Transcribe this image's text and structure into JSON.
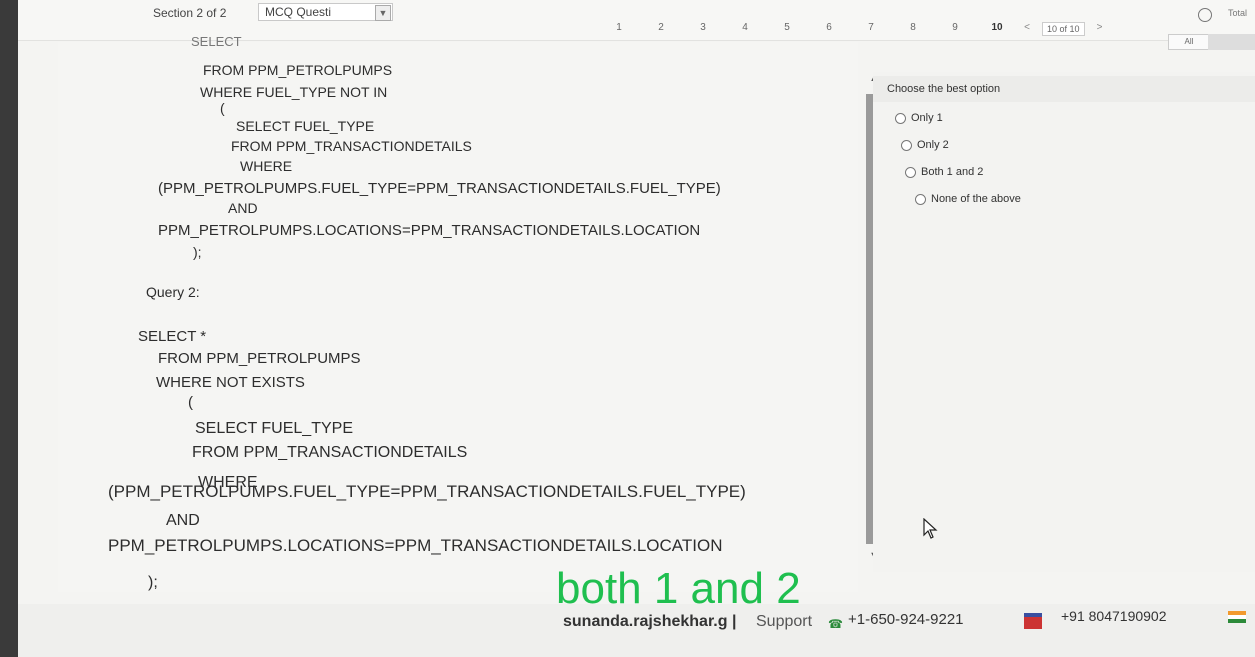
{
  "header": {
    "section_label": "Section 2 of 2",
    "section_select_value": "MCQ Questi",
    "pages": [
      "1",
      "2",
      "3",
      "4",
      "5",
      "6",
      "7",
      "8",
      "9",
      "10"
    ],
    "current_page": "10",
    "prev_symbol": "<",
    "page_select_value": "10 of 10",
    "next_symbol": ">",
    "filter_value": "All",
    "timer_label": "Total"
  },
  "question": {
    "lines": [
      "SELECT",
      "FROM PPM_PETROLPUMPS",
      "WHERE FUEL_TYPE NOT IN",
      "(",
      "SELECT FUEL_TYPE",
      "FROM PPM_TRANSACTIONDETAILS",
      "WHERE",
      "(PPM_PETROLPUMPS.FUEL_TYPE=PPM_TRANSACTIONDETAILS.FUEL_TYPE)",
      "AND",
      "PPM_PETROLPUMPS.LOCATIONS=PPM_TRANSACTIONDETAILS.LOCATION",
      ");",
      "Query 2:",
      "SELECT *",
      "FROM PPM_PETROLPUMPS",
      "WHERE NOT EXISTS",
      "(",
      "SELECT FUEL_TYPE",
      "FROM PPM_TRANSACTIONDETAILS",
      "WHERE",
      "(PPM_PETROLPUMPS.FUEL_TYPE=PPM_TRANSACTIONDETAILS.FUEL_TYPE)",
      "AND",
      "PPM_PETROLPUMPS.LOCATIONS=PPM_TRANSACTIONDETAILS.LOCATION",
      ");"
    ]
  },
  "answers": {
    "heading": "Choose the best option",
    "options": [
      "Only 1",
      "Only 2",
      "Both 1 and 2",
      "None of the above"
    ]
  },
  "overlay": {
    "text": "both 1 and 2",
    "color": "#1fbf4f"
  },
  "footer": {
    "user": "sunanda.rajshekhar.g",
    "separator": "|",
    "support": "Support",
    "phone_us": "+1-650-924-9221",
    "phone_in": "+91 8047190902"
  }
}
